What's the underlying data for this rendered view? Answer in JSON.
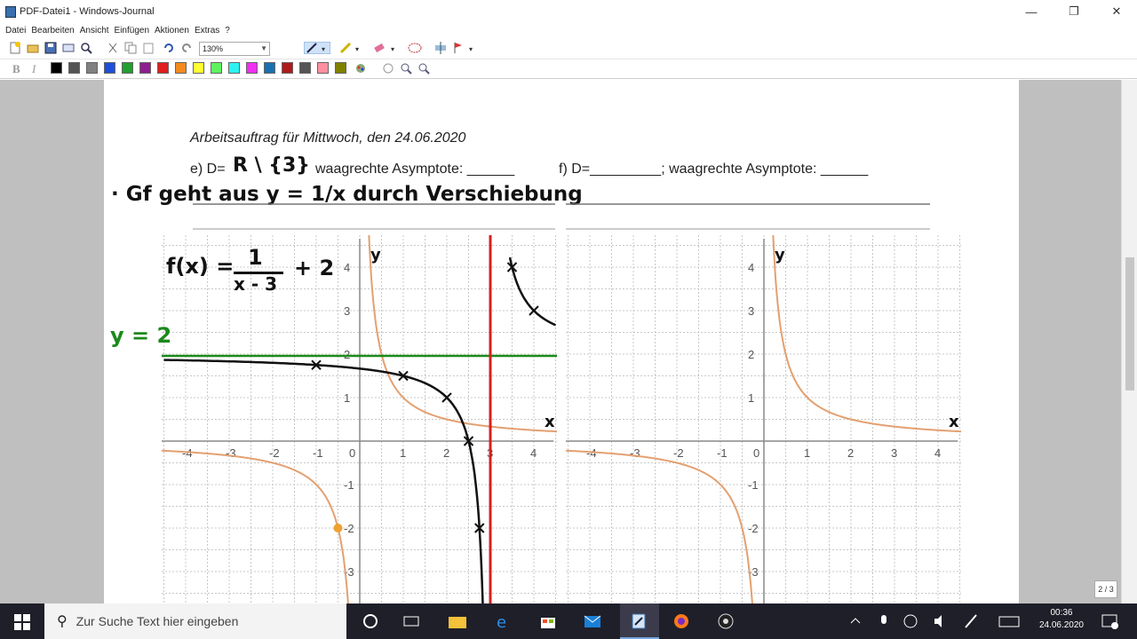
{
  "window": {
    "title": "PDF-Datei1 - Windows-Journal",
    "minimize": "—",
    "restore": "❐",
    "close": "✕"
  },
  "menu": [
    "Datei",
    "Bearbeiten",
    "Ansicht",
    "Einfügen",
    "Aktionen",
    "Extras",
    "?"
  ],
  "toolbar": {
    "zoom": "130%",
    "bold": "B",
    "italic": "I"
  },
  "colors": [
    "#000000",
    "#555555",
    "#808080",
    "#1e4fd8",
    "#1fa02f",
    "#8e1f8e",
    "#e01f1f",
    "#f28a1f",
    "#ffff33",
    "#5ff25f",
    "#2ef2f2",
    "#f22ef2",
    "#1a6fb0",
    "#b01a1a",
    "#555555",
    "#ff8fa0",
    "#808000"
  ],
  "document": {
    "title": "Arbeitsauftrag für Mittwoch, den 24.06.2020",
    "line_e_prefix": "e) D=",
    "line_e_domain": "R \\ {3}",
    "line_e_asymptote": "waagrechte Asymptote: ______",
    "line_f": "f) D=_________; waagrechte Asymptote: ______",
    "handwritten_note": "· Gf geht aus y = 1/x durch Verschiebung",
    "formula_lhs": "f(x) =",
    "formula_num": "1",
    "formula_den": "x - 3",
    "formula_rest": "+ 2",
    "asymptote_label": "y = 2"
  },
  "graph_left": {
    "x_ticks": [
      "-4",
      "-3",
      "-2",
      "-1",
      "0",
      "1",
      "2",
      "3",
      "4"
    ],
    "y_ticks": [
      "4",
      "3",
      "2",
      "1",
      "-1",
      "-2",
      "-3"
    ],
    "x_label": "x",
    "y_label": "y"
  },
  "graph_right": {
    "x_ticks": [
      "-4",
      "-3",
      "-2",
      "-1",
      "0",
      "1",
      "2",
      "3",
      "4"
    ],
    "y_ticks": [
      "4",
      "3",
      "2",
      "1",
      "-1",
      "-2",
      "-3"
    ],
    "x_label": "x",
    "y_label": "y"
  },
  "page_indicator": "2 / 3",
  "taskbar": {
    "search_placeholder": "Zur Suche Text hier eingeben",
    "time": "00:36",
    "date": "24.06.2020"
  }
}
